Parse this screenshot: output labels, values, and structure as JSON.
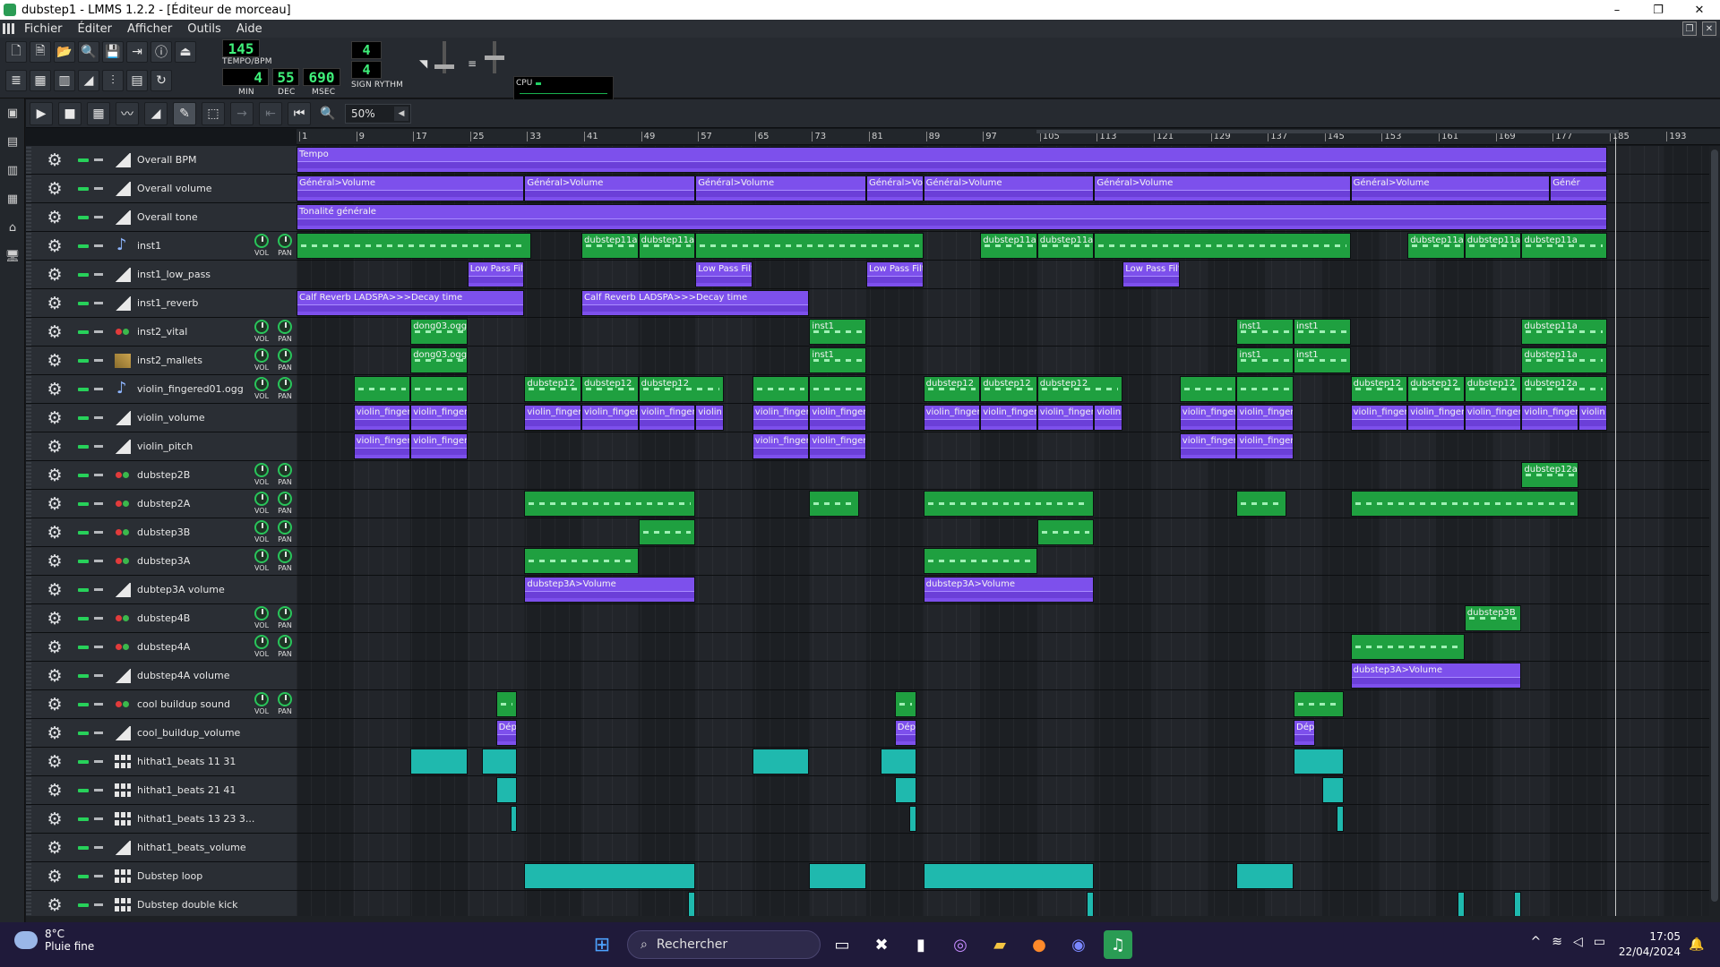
{
  "window": {
    "title": "dubstep1 - LMMS 1.2.2 - [Éditeur de morceau]",
    "minimize": "–",
    "maximize": "❐",
    "close": "✕"
  },
  "menu": [
    "Fichier",
    "Éditer",
    "Afficher",
    "Outils",
    "Aide"
  ],
  "toolbar": {
    "tempo": "145",
    "tempo_label": "TEMPO/BPM",
    "time_min": "4",
    "time_dec": "55",
    "time_msec": "690",
    "min_label": "MIN",
    "dec_label": "DEC",
    "msec_label": "MSEC",
    "sig_num": "4",
    "sig_den": "4",
    "sig_label": "SIGN RYTHM",
    "cpu_label": "CPU"
  },
  "editor": {
    "zoom": "50%"
  },
  "ruler": [
    "1",
    "9",
    "17",
    "25",
    "33",
    "41",
    "49",
    "57",
    "65",
    "73",
    "81",
    "89",
    "97",
    "105",
    "113",
    "121",
    "129",
    "137",
    "145",
    "153",
    "161",
    "169",
    "177",
    "185",
    "193"
  ],
  "tracks": [
    {
      "name": "Overall BPM",
      "icon": "auto",
      "knobs": false,
      "clips": [
        {
          "s": 1,
          "e": 185,
          "t": "auto",
          "label": "Tempo"
        }
      ]
    },
    {
      "name": "Overall volume",
      "icon": "auto",
      "knobs": false,
      "clips": [
        {
          "s": 1,
          "e": 33,
          "t": "auto",
          "label": "Général>Volume"
        },
        {
          "s": 33,
          "e": 57,
          "t": "auto",
          "label": "Général>Volume"
        },
        {
          "s": 57,
          "e": 81,
          "t": "auto",
          "label": "Général>Volume"
        },
        {
          "s": 81,
          "e": 89,
          "t": "auto",
          "label": "Général>Volu"
        },
        {
          "s": 89,
          "e": 113,
          "t": "auto",
          "label": "Général>Volume"
        },
        {
          "s": 113,
          "e": 149,
          "t": "auto",
          "label": "Général>Volume"
        },
        {
          "s": 149,
          "e": 177,
          "t": "auto",
          "label": "Général>Volume"
        },
        {
          "s": 177,
          "e": 185,
          "t": "auto",
          "label": "Génér"
        }
      ]
    },
    {
      "name": "Overall tone",
      "icon": "auto",
      "knobs": false,
      "clips": [
        {
          "s": 1,
          "e": 185,
          "t": "auto",
          "label": "Tonalité générale"
        }
      ]
    },
    {
      "name": "inst1",
      "icon": "inst",
      "knobs": true,
      "clips": [
        {
          "s": 1,
          "e": 34,
          "t": "green",
          "label": ""
        },
        {
          "s": 41,
          "e": 49,
          "t": "green",
          "label": "dubstep11a"
        },
        {
          "s": 49,
          "e": 57,
          "t": "green",
          "label": "dubstep11a"
        },
        {
          "s": 57,
          "e": 89,
          "t": "green",
          "label": ""
        },
        {
          "s": 97,
          "e": 105,
          "t": "green",
          "label": "dubstep11a"
        },
        {
          "s": 105,
          "e": 113,
          "t": "green",
          "label": "dubstep11a"
        },
        {
          "s": 113,
          "e": 149,
          "t": "green",
          "label": ""
        },
        {
          "s": 157,
          "e": 165,
          "t": "green",
          "label": "dubstep11a"
        },
        {
          "s": 165,
          "e": 173,
          "t": "green",
          "label": "dubstep11a"
        },
        {
          "s": 173,
          "e": 185,
          "t": "green",
          "label": "dubstep11a"
        }
      ]
    },
    {
      "name": "inst1_low_pass",
      "icon": "auto",
      "knobs": false,
      "clips": [
        {
          "s": 25,
          "e": 33,
          "t": "auto",
          "label": "Low Pass Filt"
        },
        {
          "s": 57,
          "e": 65,
          "t": "auto",
          "label": "Low Pass Filt"
        },
        {
          "s": 81,
          "e": 89,
          "t": "auto",
          "label": "Low Pass Filt"
        },
        {
          "s": 117,
          "e": 125,
          "t": "auto",
          "label": "Low Pass Filt"
        }
      ]
    },
    {
      "name": "inst1_reverb",
      "icon": "auto",
      "knobs": false,
      "clips": [
        {
          "s": 1,
          "e": 33,
          "t": "auto",
          "label": "Calf Reverb LADSPA>>>Decay time"
        },
        {
          "s": 41,
          "e": 73,
          "t": "auto",
          "label": "Calf Reverb LADSPA>>>Decay time"
        }
      ]
    },
    {
      "name": "inst2_vital",
      "icon": "vital",
      "knobs": true,
      "clips": [
        {
          "s": 17,
          "e": 25,
          "t": "green",
          "label": "dong03.ogg"
        },
        {
          "s": 73,
          "e": 81,
          "t": "green",
          "label": "inst1"
        },
        {
          "s": 133,
          "e": 141,
          "t": "green",
          "label": "inst1"
        },
        {
          "s": 141,
          "e": 149,
          "t": "green",
          "label": "inst1"
        },
        {
          "s": 173,
          "e": 185,
          "t": "green",
          "label": "dubstep11a"
        }
      ]
    },
    {
      "name": "inst2_mallets",
      "icon": "mallet",
      "knobs": true,
      "clips": [
        {
          "s": 17,
          "e": 25,
          "t": "green",
          "label": "dong03.ogg"
        },
        {
          "s": 73,
          "e": 81,
          "t": "green",
          "label": "inst1"
        },
        {
          "s": 133,
          "e": 141,
          "t": "green",
          "label": "inst1"
        },
        {
          "s": 141,
          "e": 149,
          "t": "green",
          "label": "inst1"
        },
        {
          "s": 173,
          "e": 185,
          "t": "green",
          "label": "dubstep11a"
        }
      ]
    },
    {
      "name": "violin_fingered01.ogg",
      "icon": "inst",
      "knobs": true,
      "clips": [
        {
          "s": 9,
          "e": 17,
          "t": "green",
          "label": ""
        },
        {
          "s": 17,
          "e": 25,
          "t": "green",
          "label": ""
        },
        {
          "s": 33,
          "e": 41,
          "t": "green",
          "label": "dubstep12"
        },
        {
          "s": 41,
          "e": 49,
          "t": "green",
          "label": "dubstep12"
        },
        {
          "s": 49,
          "e": 61,
          "t": "green",
          "label": "dubstep12"
        },
        {
          "s": 65,
          "e": 73,
          "t": "green",
          "label": ""
        },
        {
          "s": 73,
          "e": 81,
          "t": "green",
          "label": ""
        },
        {
          "s": 89,
          "e": 97,
          "t": "green",
          "label": "dubstep12"
        },
        {
          "s": 97,
          "e": 105,
          "t": "green",
          "label": "dubstep12"
        },
        {
          "s": 105,
          "e": 117,
          "t": "green",
          "label": "dubstep12"
        },
        {
          "s": 125,
          "e": 133,
          "t": "green",
          "label": ""
        },
        {
          "s": 133,
          "e": 141,
          "t": "green",
          "label": ""
        },
        {
          "s": 149,
          "e": 157,
          "t": "green",
          "label": "dubstep12"
        },
        {
          "s": 157,
          "e": 165,
          "t": "green",
          "label": "dubstep12"
        },
        {
          "s": 165,
          "e": 173,
          "t": "green",
          "label": "dubstep12"
        },
        {
          "s": 173,
          "e": 185,
          "t": "green",
          "label": "dubstep12a"
        }
      ]
    },
    {
      "name": "violin_volume",
      "icon": "auto",
      "knobs": false,
      "clips": [
        {
          "s": 9,
          "e": 17,
          "t": "auto",
          "label": "violin_finger"
        },
        {
          "s": 17,
          "e": 25,
          "t": "auto",
          "label": "violin_finger"
        },
        {
          "s": 33,
          "e": 41,
          "t": "auto",
          "label": "violin_finger"
        },
        {
          "s": 41,
          "e": 49,
          "t": "auto",
          "label": "violin_finger"
        },
        {
          "s": 49,
          "e": 57,
          "t": "auto",
          "label": "violin_finger"
        },
        {
          "s": 57,
          "e": 61,
          "t": "auto",
          "label": "violin"
        },
        {
          "s": 65,
          "e": 73,
          "t": "auto",
          "label": "violin_finger"
        },
        {
          "s": 73,
          "e": 81,
          "t": "auto",
          "label": "violin_finger"
        },
        {
          "s": 89,
          "e": 97,
          "t": "auto",
          "label": "violin_finger"
        },
        {
          "s": 97,
          "e": 105,
          "t": "auto",
          "label": "violin_finger"
        },
        {
          "s": 105,
          "e": 113,
          "t": "auto",
          "label": "violin_finger"
        },
        {
          "s": 113,
          "e": 117,
          "t": "auto",
          "label": "violin"
        },
        {
          "s": 125,
          "e": 133,
          "t": "auto",
          "label": "violin_finger"
        },
        {
          "s": 133,
          "e": 141,
          "t": "auto",
          "label": "violin_finger"
        },
        {
          "s": 149,
          "e": 157,
          "t": "auto",
          "label": "violin_finger"
        },
        {
          "s": 157,
          "e": 165,
          "t": "auto",
          "label": "violin_finger"
        },
        {
          "s": 165,
          "e": 173,
          "t": "auto",
          "label": "violin_finger"
        },
        {
          "s": 173,
          "e": 181,
          "t": "auto",
          "label": "violin_finger"
        },
        {
          "s": 181,
          "e": 185,
          "t": "auto",
          "label": "violin"
        }
      ]
    },
    {
      "name": "violin_pitch",
      "icon": "auto",
      "knobs": false,
      "clips": [
        {
          "s": 9,
          "e": 17,
          "t": "auto",
          "label": "violin_finger"
        },
        {
          "s": 17,
          "e": 25,
          "t": "auto",
          "label": "violin_finger"
        },
        {
          "s": 65,
          "e": 73,
          "t": "auto",
          "label": "violin_finger"
        },
        {
          "s": 73,
          "e": 81,
          "t": "auto",
          "label": "violin_finger"
        },
        {
          "s": 125,
          "e": 133,
          "t": "auto",
          "label": "violin_finger"
        },
        {
          "s": 133,
          "e": 141,
          "t": "auto",
          "label": "violin_finger"
        }
      ]
    },
    {
      "name": "dubstep2B",
      "icon": "vital",
      "knobs": true,
      "clips": [
        {
          "s": 173,
          "e": 181,
          "t": "green",
          "label": "dubstep12a"
        }
      ]
    },
    {
      "name": "dubstep2A",
      "icon": "vital",
      "knobs": true,
      "clips": [
        {
          "s": 33,
          "e": 57,
          "t": "green",
          "label": ""
        },
        {
          "s": 73,
          "e": 80,
          "t": "green",
          "label": ""
        },
        {
          "s": 89,
          "e": 113,
          "t": "green",
          "label": ""
        },
        {
          "s": 133,
          "e": 140,
          "t": "green",
          "label": ""
        },
        {
          "s": 149,
          "e": 181,
          "t": "green",
          "label": ""
        }
      ]
    },
    {
      "name": "dubstep3B",
      "icon": "vital",
      "knobs": true,
      "clips": [
        {
          "s": 49,
          "e": 57,
          "t": "green",
          "label": ""
        },
        {
          "s": 105,
          "e": 113,
          "t": "green",
          "label": ""
        }
      ]
    },
    {
      "name": "dubstep3A",
      "icon": "vital",
      "knobs": true,
      "clips": [
        {
          "s": 33,
          "e": 49,
          "t": "green",
          "label": ""
        },
        {
          "s": 89,
          "e": 105,
          "t": "green",
          "label": ""
        }
      ]
    },
    {
      "name": "dubtep3A volume",
      "icon": "auto",
      "knobs": false,
      "clips": [
        {
          "s": 33,
          "e": 57,
          "t": "auto",
          "label": "dubstep3A>Volume"
        },
        {
          "s": 89,
          "e": 113,
          "t": "auto",
          "label": "dubstep3A>Volume"
        }
      ]
    },
    {
      "name": "dubstep4B",
      "icon": "vital",
      "knobs": true,
      "clips": [
        {
          "s": 165,
          "e": 173,
          "t": "green",
          "label": "dubstep3B"
        }
      ]
    },
    {
      "name": "dubstep4A",
      "icon": "vital",
      "knobs": true,
      "clips": [
        {
          "s": 149,
          "e": 165,
          "t": "green",
          "label": ""
        }
      ]
    },
    {
      "name": "dubstep4A volume",
      "icon": "auto",
      "knobs": false,
      "clips": [
        {
          "s": 149,
          "e": 173,
          "t": "auto",
          "label": "dubstep3A>Volume"
        }
      ]
    },
    {
      "name": "cool buildup sound",
      "icon": "vital",
      "knobs": true,
      "clips": [
        {
          "s": 29,
          "e": 32,
          "t": "green",
          "label": ""
        },
        {
          "s": 85,
          "e": 88,
          "t": "green",
          "label": ""
        },
        {
          "s": 141,
          "e": 148,
          "t": "green",
          "label": ""
        }
      ]
    },
    {
      "name": "cool_buildup_volume",
      "icon": "auto",
      "knobs": false,
      "clips": [
        {
          "s": 29,
          "e": 32,
          "t": "auto",
          "label": "Dépl"
        },
        {
          "s": 85,
          "e": 88,
          "t": "auto",
          "label": "Dépl"
        },
        {
          "s": 141,
          "e": 144,
          "t": "auto",
          "label": "Dépl"
        }
      ]
    },
    {
      "name": "hithat1_beats 11 31",
      "icon": "pat",
      "knobs": false,
      "clips": [
        {
          "s": 17,
          "e": 25,
          "t": "cyan",
          "label": ""
        },
        {
          "s": 27,
          "e": 32,
          "t": "cyan",
          "label": ""
        },
        {
          "s": 65,
          "e": 73,
          "t": "cyan",
          "label": ""
        },
        {
          "s": 83,
          "e": 88,
          "t": "cyan",
          "label": ""
        },
        {
          "s": 141,
          "e": 148,
          "t": "cyan",
          "label": ""
        }
      ]
    },
    {
      "name": "hithat1_beats 21 41",
      "icon": "pat",
      "knobs": false,
      "clips": [
        {
          "s": 29,
          "e": 32,
          "t": "cyan",
          "label": ""
        },
        {
          "s": 85,
          "e": 88,
          "t": "cyan",
          "label": ""
        },
        {
          "s": 145,
          "e": 148,
          "t": "cyan",
          "label": ""
        }
      ]
    },
    {
      "name": "hithat1_beats 13 23 3...",
      "icon": "pat",
      "knobs": false,
      "clips": [
        {
          "s": 31,
          "e": 32,
          "t": "cyan",
          "label": ""
        },
        {
          "s": 87,
          "e": 88,
          "t": "cyan",
          "label": ""
        },
        {
          "s": 147,
          "e": 148,
          "t": "cyan",
          "label": ""
        }
      ]
    },
    {
      "name": "hithat1_beats_volume",
      "icon": "auto",
      "knobs": false,
      "clips": []
    },
    {
      "name": "Dubstep loop",
      "icon": "pat",
      "knobs": false,
      "clips": [
        {
          "s": 33,
          "e": 57,
          "t": "cyan",
          "label": ""
        },
        {
          "s": 73,
          "e": 81,
          "t": "cyan",
          "label": ""
        },
        {
          "s": 89,
          "e": 113,
          "t": "cyan",
          "label": ""
        },
        {
          "s": 133,
          "e": 141,
          "t": "cyan",
          "label": ""
        }
      ]
    },
    {
      "name": "Dubstep double kick",
      "icon": "pat",
      "knobs": false,
      "clips": [
        {
          "s": 56,
          "e": 57,
          "t": "cyan",
          "label": ""
        },
        {
          "s": 112,
          "e": 113,
          "t": "cyan",
          "label": ""
        },
        {
          "s": 164,
          "e": 165,
          "t": "cyan",
          "label": ""
        },
        {
          "s": 172,
          "e": 173,
          "t": "cyan",
          "label": ""
        }
      ]
    }
  ],
  "taskbar": {
    "temp": "8°C",
    "weather": "Pluie fine",
    "search": "Rechercher",
    "time": "17:05",
    "date": "22/04/2024"
  },
  "colors": {
    "automation": "#7d50ec",
    "pattern_green": "#1fa040",
    "beat_cyan": "#1fb9ae",
    "lcd": "#3ff07a"
  }
}
